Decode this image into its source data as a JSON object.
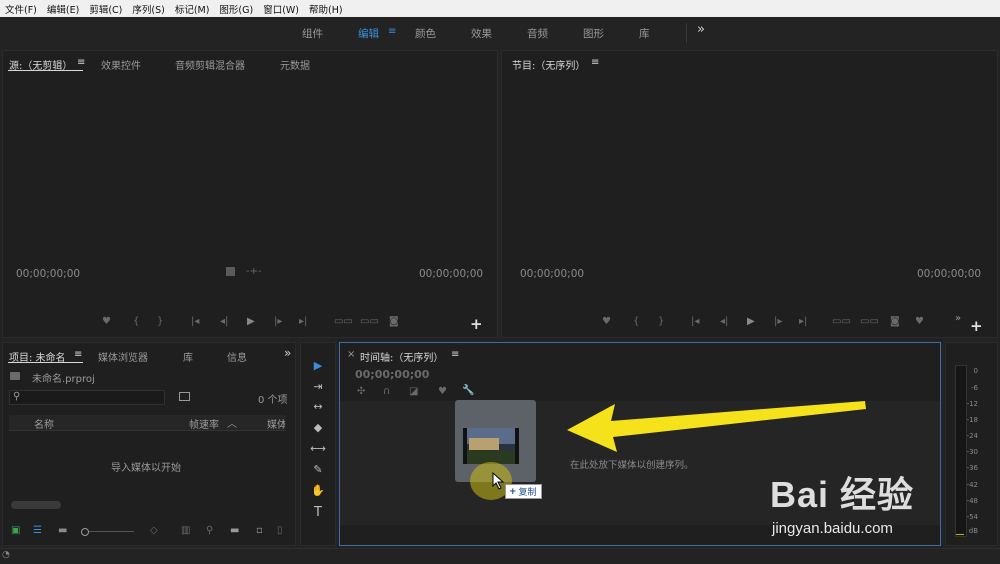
{
  "menu": [
    "文件(F)",
    "编辑(E)",
    "剪辑(C)",
    "序列(S)",
    "标记(M)",
    "图形(G)",
    "窗口(W)",
    "帮助(H)"
  ],
  "workspaces": [
    "组件",
    "编辑",
    "颜色",
    "效果",
    "音频",
    "图形",
    "库"
  ],
  "workspace_more": "»",
  "source": {
    "tabs": [
      "源:（无剪辑）",
      "效果控件",
      "音频剪辑混合器",
      "元数据"
    ],
    "timecode_left": "00;00;00;00",
    "timecode_right": "00;00;00;00",
    "add": "+"
  },
  "program": {
    "tab": "节目:（无序列）",
    "timecode_left": "00;00;00;00",
    "timecode_right": "00;00;00;00",
    "add": "+",
    "more": "»"
  },
  "project": {
    "tabs": [
      "项目: 未命名",
      "媒体浏览器",
      "库",
      "信息"
    ],
    "more": "»",
    "file": "未命名.prproj",
    "count": "0 个项",
    "columns": [
      "名称",
      "帧速率",
      "媒体"
    ],
    "empty": "导入媒体以开始"
  },
  "timeline": {
    "close": "×",
    "tab": "时间轴:（无序列）",
    "timecode": "00;00;00;00",
    "drop_hint": "在此处放下媒体以创建序列。",
    "copy_label": "复制",
    "copy_plus": "+"
  },
  "meter": {
    "labels": [
      "0",
      "-6",
      "-12",
      "-18",
      "-24",
      "-30",
      "-36",
      "-42",
      "-48",
      "-54",
      "dB"
    ]
  },
  "watermark": {
    "logo": "Bai 经验",
    "url": "jingyan.baidu.com"
  },
  "colors": {
    "accent": "#3a8fdb",
    "arrow": "#f6e21a"
  }
}
